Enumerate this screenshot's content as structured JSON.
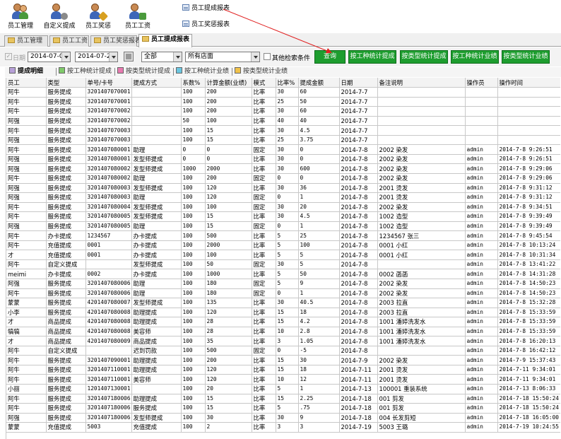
{
  "toolbar": {
    "buttons": [
      {
        "label": "员工管理",
        "icon": "staff-icon",
        "accent": "#3d66b8"
      },
      {
        "label": "自定义提成",
        "icon": "custom-commission-icon",
        "accent": "#7a7a7a"
      },
      {
        "label": "员工奖惩",
        "icon": "reward-punish-icon",
        "accent": "#d8a020"
      },
      {
        "label": "员工工资",
        "icon": "salary-icon",
        "accent": "#4a9a3c"
      }
    ],
    "report_links": [
      "员工提成报表",
      "员工奖惩报表"
    ]
  },
  "tabs": [
    {
      "label": "员工管理",
      "active": false
    },
    {
      "label": "员工工资",
      "active": false
    },
    {
      "label": "员工奖惩报表",
      "active": false
    },
    {
      "label": "员工提成报表",
      "active": true
    }
  ],
  "filters": {
    "date_label": "日期",
    "date_checked": true,
    "start_date": "2014-07-01",
    "end_date": "2014-07-21",
    "type_value": "全部",
    "store_value": "所有店面",
    "other_conditions_label": "其他检索条件",
    "buttons": [
      "查询",
      "按工种统计提成",
      "按类型统计提成",
      "按工种统计业绩",
      "按类型统计业绩"
    ],
    "button_color": "#1e9d2f"
  },
  "subtabs": [
    {
      "label": "提成明细",
      "color": "#b7a0d8",
      "active": true
    },
    {
      "label": "按工种统计提成",
      "color": "#7fc96a",
      "active": false
    },
    {
      "label": "按类型统计提成",
      "color": "#e87ab0",
      "active": false
    },
    {
      "label": "按工种统计业绩",
      "color": "#6ac6e0",
      "active": false
    },
    {
      "label": "按类型统计业绩",
      "color": "#f0c24a",
      "active": false
    }
  ],
  "table": {
    "columns": [
      "员工",
      "类型",
      "单号/卡号",
      "提成方式",
      "系数%",
      "计算金额(业绩)",
      "模式",
      "比率%",
      "提成金额",
      "日期",
      "备注说明",
      "操作员",
      "操作时间"
    ],
    "rows": [
      [
        "阿牛",
        "服务提成",
        "3201407070001",
        "",
        "100",
        "200",
        "比率",
        "30",
        "60",
        "2014-7-7",
        "",
        "",
        ""
      ],
      [
        "阿牛",
        "服务提成",
        "3201407070001",
        "",
        "100",
        "200",
        "比率",
        "25",
        "50",
        "2014-7-7",
        "",
        "",
        ""
      ],
      [
        "阿牛",
        "服务提成",
        "3201407070002",
        "",
        "100",
        "200",
        "比率",
        "30",
        "60",
        "2014-7-7",
        "",
        "",
        ""
      ],
      [
        "阿强",
        "服务提成",
        "3201407070002",
        "",
        "50",
        "100",
        "比率",
        "40",
        "40",
        "2014-7-7",
        "",
        "",
        ""
      ],
      [
        "阿牛",
        "服务提成",
        "3201407070003",
        "",
        "100",
        "15",
        "比率",
        "30",
        "4.5",
        "2014-7-7",
        "",
        "",
        ""
      ],
      [
        "阿强",
        "服务提成",
        "3201407070003",
        "",
        "100",
        "15",
        "比率",
        "25",
        "3.75",
        "2014-7-7",
        "",
        "",
        ""
      ],
      [
        "阿牛",
        "服务提成",
        "3201407080001",
        "助理",
        "0",
        "0",
        "固定",
        "30",
        "0",
        "2014-7-8",
        "2002 染发",
        "admin",
        "2014-7-8 9:26:51"
      ],
      [
        "阿强",
        "服务提成",
        "3201407080001",
        "发型师提成",
        "0",
        "0",
        "比率",
        "30",
        "0",
        "2014-7-8",
        "2002 染发",
        "admin",
        "2014-7-8 9:26:51"
      ],
      [
        "阿强",
        "服务提成",
        "3201407080002",
        "发型师提成",
        "1000",
        "2000",
        "比率",
        "30",
        "600",
        "2014-7-8",
        "2002 染发",
        "admin",
        "2014-7-8 9:29:06"
      ],
      [
        "阿牛",
        "服务提成",
        "3201407080002",
        "助理",
        "100",
        "200",
        "固定",
        "0",
        "0",
        "2014-7-8",
        "2002 染发",
        "admin",
        "2014-7-8 9:29:06"
      ],
      [
        "阿强",
        "服务提成",
        "3201407080003",
        "发型师提成",
        "100",
        "120",
        "比率",
        "30",
        "36",
        "2014-7-8",
        "2001 烫发",
        "admin",
        "2014-7-8 9:31:12"
      ],
      [
        "阿强",
        "服务提成",
        "3201407080003",
        "助理",
        "100",
        "120",
        "固定",
        "0",
        "1",
        "2014-7-8",
        "2001 烫发",
        "admin",
        "2014-7-8 9:31:12"
      ],
      [
        "阿牛",
        "服务提成",
        "3201407080004",
        "发型师提成",
        "100",
        "100",
        "固定",
        "30",
        "20",
        "2014-7-8",
        "2002 染发",
        "admin",
        "2014-7-8 9:34:51"
      ],
      [
        "阿牛",
        "服务提成",
        "3201407080005",
        "发型师提成",
        "100",
        "15",
        "比率",
        "30",
        "4.5",
        "2014-7-8",
        "1002 造型",
        "admin",
        "2014-7-8 9:39:49"
      ],
      [
        "阿强",
        "服务提成",
        "3201407080005",
        "助理",
        "100",
        "15",
        "固定",
        "0",
        "1",
        "2014-7-8",
        "1002 造型",
        "admin",
        "2014-7-8 9:39:49"
      ],
      [
        "阿牛",
        "办卡提成",
        "1234567",
        "办卡提成",
        "100",
        "500",
        "比率",
        "5",
        "25",
        "2014-7-8",
        "1234567 张三",
        "admin",
        "2014-7-8 9:45:54"
      ],
      [
        "阿牛",
        "充值提成",
        "0001",
        "办卡提成",
        "100",
        "2000",
        "比率",
        "5",
        "100",
        "2014-7-8",
        "0001 小红",
        "admin",
        "2014-7-8 10:13:24"
      ],
      [
        "才",
        "充值提成",
        "0001",
        "办卡提成",
        "100",
        "100",
        "比率",
        "5",
        "5",
        "2014-7-8",
        "0001 小红",
        "admin",
        "2014-7-8 10:31:34"
      ],
      [
        "阿牛",
        "自定义提成",
        "",
        "发型师提成",
        "100",
        "50",
        "固定",
        "30",
        "5",
        "2014-7-8",
        "",
        "admin",
        "2014-7-8 13:41:22"
      ],
      [
        "meimi",
        "办卡提成",
        "0002",
        "办卡提成",
        "100",
        "1000",
        "比率",
        "5",
        "50",
        "2014-7-8",
        "0002 菡菡",
        "admin",
        "2014-7-8 14:31:28"
      ],
      [
        "阿强",
        "服务提成",
        "3201407080006",
        "助理",
        "100",
        "180",
        "固定",
        "5",
        "9",
        "2014-7-8",
        "2002 染发",
        "admin",
        "2014-7-8 14:50:23"
      ],
      [
        "阿牛",
        "服务提成",
        "3201407080006",
        "助理",
        "100",
        "180",
        "固定",
        "0",
        "1",
        "2014-7-8",
        "2002 染发",
        "admin",
        "2014-7-8 14:50:23"
      ],
      [
        "蒙蒙",
        "服务提成",
        "4201407080007",
        "发型师提成",
        "100",
        "135",
        "比率",
        "30",
        "40.5",
        "2014-7-8",
        "2003 拉直",
        "admin",
        "2014-7-8 15:32:28"
      ],
      [
        "小李",
        "服务提成",
        "4201407080008",
        "助理提成",
        "100",
        "120",
        "比率",
        "15",
        "18",
        "2014-7-8",
        "2003 拉直",
        "admin",
        "2014-7-8 15:33:59"
      ],
      [
        "才",
        "商品提成",
        "4201407080008",
        "助理提成",
        "100",
        "28",
        "比率",
        "15",
        "4.2",
        "2014-7-8",
        "1001 潘婷洗发水",
        "admin",
        "2014-7-8 15:33:59"
      ],
      [
        "犒犒",
        "商品提成",
        "4201407080008",
        "美容师",
        "100",
        "28",
        "比率",
        "10",
        "2.8",
        "2014-7-8",
        "1001 潘婷洗发水",
        "admin",
        "2014-7-8 15:33:59"
      ],
      [
        "才",
        "商品提成",
        "4201407080009",
        "商品提成",
        "100",
        "35",
        "比率",
        "3",
        "1.05",
        "2014-7-8",
        "1001 潘婷洗发水",
        "admin",
        "2014-7-8 16:20:13"
      ],
      [
        "阿牛",
        "自定义提成",
        "",
        "迟到罚款",
        "100",
        "500",
        "固定",
        "0",
        "-5",
        "2014-7-8",
        "",
        "admin",
        "2014-7-8 16:42:12"
      ],
      [
        "阿牛",
        "服务提成",
        "3201407090001",
        "助理提成",
        "100",
        "200",
        "比率",
        "15",
        "30",
        "2014-7-9",
        "2002 染发",
        "admin",
        "2014-7-9 15:37:43"
      ],
      [
        "阿牛",
        "服务提成",
        "3201407110001",
        "助理提成",
        "100",
        "120",
        "比率",
        "15",
        "18",
        "2014-7-11",
        "2001 烫发",
        "admin",
        "2014-7-11 9:34:01"
      ],
      [
        "阿牛",
        "服务提成",
        "3201407110001",
        "美容师",
        "100",
        "120",
        "比率",
        "10",
        "12",
        "2014-7-11",
        "2001 烫发",
        "admin",
        "2014-7-11 9:34:01"
      ],
      [
        "小丽",
        "服务提成",
        "1201407130001",
        "",
        "100",
        "20",
        "比率",
        "5",
        "1",
        "2014-7-13",
        "100001 重装系统",
        "admin",
        "2014-7-13 8:06:33"
      ],
      [
        "阿牛",
        "服务提成",
        "3201407180006",
        "助理提成",
        "100",
        "15",
        "比率",
        "15",
        "2.25",
        "2014-7-18",
        "001 剪发",
        "admin",
        "2014-7-18 15:50:24"
      ],
      [
        "阿牛",
        "服务提成",
        "3201407180006",
        "服务提成",
        "100",
        "15",
        "比率",
        "5",
        ".75",
        "2014-7-18",
        "001 剪发",
        "admin",
        "2014-7-18 15:50:24"
      ],
      [
        "阿强",
        "服务提成",
        "3201407180006",
        "发型师提成",
        "100",
        "30",
        "比率",
        "30",
        "9",
        "2014-7-18",
        "004 长发剪短",
        "admin",
        "2014-7-18 16:05:00"
      ],
      [
        "蒙蒙",
        "充值提成",
        "5003",
        "充值提成",
        "100",
        "2",
        "比率",
        "3",
        "3",
        "2014-7-19",
        "5003 王璐",
        "admin",
        "2014-7-19 10:24:55"
      ]
    ]
  }
}
